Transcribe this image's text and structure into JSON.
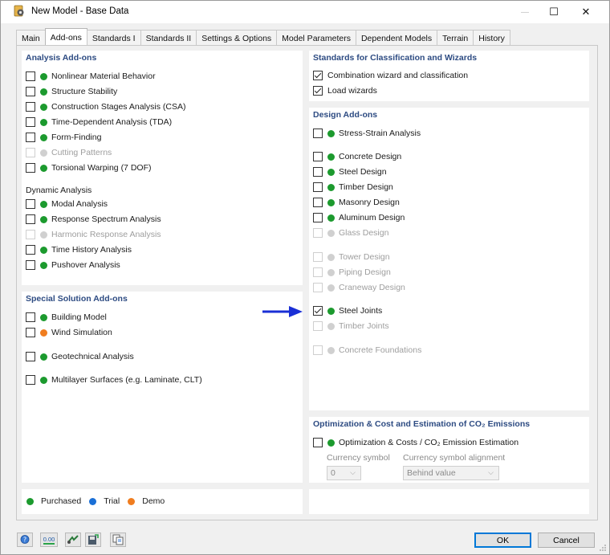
{
  "window": {
    "title": "New Model - Base Data",
    "minimize_glyph": "—",
    "maximize_glyph": "☐",
    "close_glyph": "✕"
  },
  "tabs": [
    {
      "label": "Main",
      "active": false
    },
    {
      "label": "Add-ons",
      "active": true
    },
    {
      "label": "Standards I",
      "active": false
    },
    {
      "label": "Standards II",
      "active": false
    },
    {
      "label": "Settings & Options",
      "active": false
    },
    {
      "label": "Model Parameters",
      "active": false
    },
    {
      "label": "Dependent Models",
      "active": false
    },
    {
      "label": "Terrain",
      "active": false
    },
    {
      "label": "History",
      "active": false
    }
  ],
  "colors": {
    "purchased": "#1c9a2e",
    "trial": "#1a6fd6",
    "demo": "#f07d1f",
    "disabled_dot": "#d0d0d0",
    "panel_title": "#2d4b82",
    "arrow": "#1a2fd6"
  },
  "analysis": {
    "title": "Analysis Add-ons",
    "items": [
      {
        "label": "Nonlinear Material Behavior",
        "checked": false,
        "enabled": true,
        "status": "purchased"
      },
      {
        "label": "Structure Stability",
        "checked": false,
        "enabled": true,
        "status": "purchased"
      },
      {
        "label": "Construction Stages Analysis (CSA)",
        "checked": false,
        "enabled": true,
        "status": "purchased"
      },
      {
        "label": "Time-Dependent Analysis (TDA)",
        "checked": false,
        "enabled": true,
        "status": "purchased"
      },
      {
        "label": "Form-Finding",
        "checked": false,
        "enabled": true,
        "status": "purchased"
      },
      {
        "label": "Cutting Patterns",
        "checked": false,
        "enabled": false,
        "status": "disabled"
      },
      {
        "label": "Torsional Warping (7 DOF)",
        "checked": false,
        "enabled": true,
        "status": "purchased"
      }
    ],
    "dynamic_label": "Dynamic Analysis",
    "dynamic_items": [
      {
        "label": "Modal Analysis",
        "checked": false,
        "enabled": true,
        "status": "purchased"
      },
      {
        "label": "Response Spectrum Analysis",
        "checked": false,
        "enabled": true,
        "status": "purchased"
      },
      {
        "label": "Harmonic Response Analysis",
        "checked": false,
        "enabled": false,
        "status": "disabled"
      },
      {
        "label": "Time History Analysis",
        "checked": false,
        "enabled": true,
        "status": "purchased"
      },
      {
        "label": "Pushover Analysis",
        "checked": false,
        "enabled": true,
        "status": "purchased"
      }
    ]
  },
  "special": {
    "title": "Special Solution Add-ons",
    "items": [
      {
        "label": "Building Model",
        "checked": false,
        "enabled": true,
        "status": "purchased"
      },
      {
        "label": "Wind Simulation",
        "checked": false,
        "enabled": true,
        "status": "demo"
      },
      {
        "label": "Geotechnical Analysis",
        "checked": false,
        "enabled": true,
        "status": "purchased"
      },
      {
        "label": "Multilayer Surfaces (e.g. Laminate, CLT)",
        "checked": false,
        "enabled": true,
        "status": "purchased"
      }
    ]
  },
  "standards": {
    "title": "Standards for Classification and Wizards",
    "items": [
      {
        "label": "Combination wizard and classification",
        "checked": true,
        "enabled": true
      },
      {
        "label": "Load wizards",
        "checked": true,
        "enabled": true
      }
    ]
  },
  "design": {
    "title": "Design Add-ons",
    "items": [
      {
        "label": "Stress-Strain Analysis",
        "checked": false,
        "enabled": true,
        "status": "purchased"
      },
      {
        "label": "Concrete Design",
        "checked": false,
        "enabled": true,
        "status": "purchased"
      },
      {
        "label": "Steel Design",
        "checked": false,
        "enabled": true,
        "status": "purchased"
      },
      {
        "label": "Timber Design",
        "checked": false,
        "enabled": true,
        "status": "purchased"
      },
      {
        "label": "Masonry Design",
        "checked": false,
        "enabled": true,
        "status": "purchased"
      },
      {
        "label": "Aluminum Design",
        "checked": false,
        "enabled": true,
        "status": "purchased"
      },
      {
        "label": "Glass Design",
        "checked": false,
        "enabled": false,
        "status": "disabled"
      },
      {
        "label": "Tower Design",
        "checked": false,
        "enabled": false,
        "status": "disabled"
      },
      {
        "label": "Piping Design",
        "checked": false,
        "enabled": false,
        "status": "disabled"
      },
      {
        "label": "Craneway Design",
        "checked": false,
        "enabled": false,
        "status": "disabled"
      },
      {
        "label": "Steel Joints",
        "checked": true,
        "enabled": true,
        "status": "purchased"
      },
      {
        "label": "Timber Joints",
        "checked": false,
        "enabled": false,
        "status": "disabled"
      },
      {
        "label": "Concrete Foundations",
        "checked": false,
        "enabled": false,
        "status": "disabled"
      }
    ]
  },
  "optimization": {
    "title": "Optimization & Cost and Estimation of CO₂ Emissions",
    "item": {
      "label": "Optimization & Costs / CO₂ Emission Estimation",
      "checked": false,
      "enabled": true,
      "status": "purchased"
    },
    "currency_symbol_label": "Currency symbol",
    "currency_symbol_value": "0",
    "alignment_label": "Currency symbol alignment",
    "alignment_value": "Behind value"
  },
  "legend": [
    {
      "label": "Purchased",
      "status": "purchased"
    },
    {
      "label": "Trial",
      "status": "trial"
    },
    {
      "label": "Demo",
      "status": "demo"
    }
  ],
  "toolbar": {
    "units_icon_text": "0.00"
  },
  "buttons": {
    "ok": "OK",
    "cancel": "Cancel"
  }
}
